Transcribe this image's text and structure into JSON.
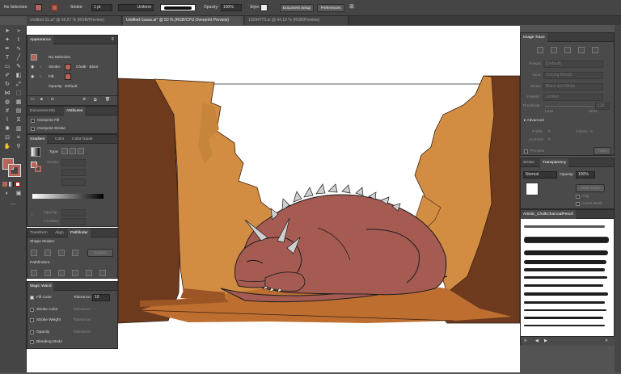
{
  "control_bar": {
    "selection": "No Selection",
    "stroke_label": "Stroke:",
    "stroke_weight": "1 pt",
    "profile": "Uniform",
    "opacity_label": "Opacity:",
    "opacity_value": "100%",
    "style_label": "Style:",
    "document_setup": "Document Setup",
    "preferences": "Preferences",
    "fill_color": "#b5655a"
  },
  "tabs": [
    {
      "label": "Untitled-11.ai* @ 66,67 % (RGB/Preview)"
    },
    {
      "label": "Untitled-1sasa.ai* @ 50 % (RGB/CPU Overprint Preview)"
    },
    {
      "label": "10294773.ai @ 94,12 % (RGB/Preview)"
    }
  ],
  "appearance": {
    "title": "Appearance",
    "selection": "No Selection",
    "stroke_label": "Stroke:",
    "stroke_value": "Chalk - Blunt",
    "fill_label": "Fill:",
    "opacity_label": "Opacity:",
    "opacity_value": "Default",
    "fx": "fx"
  },
  "doc_info": {
    "tab1": "Document Info",
    "tab2": "Attributes",
    "overprint_fill": "Overprint Fill",
    "overprint_stroke": "Overprint Stroke"
  },
  "gradient": {
    "tab1": "Gradient",
    "tab2": "Color",
    "tab3": "Color Guide",
    "type_label": "Type:",
    "stroke_label": "Stroke:",
    "opacity_label": "Opacity:",
    "location_label": "Location:"
  },
  "transform": {
    "tab1": "Transform",
    "tab2": "Align",
    "tab3": "Pathfinder",
    "shape_modes": "Shape Modes:",
    "pathfinders": "Pathfinders:",
    "expand": "Expand"
  },
  "magic_wand": {
    "title": "Magic Wand",
    "fill_color": "Fill Color",
    "tolerance": "Tolerance:",
    "tolerance_value": "10",
    "stroke_color": "Stroke Color",
    "stroke_weight": "Stroke Weight",
    "opacity": "Opacity",
    "blending_mode": "Blending Mode"
  },
  "image_trace": {
    "title": "Image Trace",
    "preset": "Preset:",
    "preset_value": "[Default]",
    "view": "View:",
    "view_value": "Tracing Result",
    "mode": "Mode:",
    "mode_value": "Black and White",
    "palette": "Palette:",
    "palette_value": "Limited",
    "threshold": "Threshold:",
    "threshold_value": "128",
    "less": "Less",
    "more": "More",
    "advanced": "Advanced",
    "paths": "Paths:",
    "paths_value": "0",
    "colors": "Colors:",
    "colors_value": "0",
    "anchors": "Anchors:",
    "anchors_value": "0",
    "preview": "Preview",
    "trace": "Trace"
  },
  "transparency": {
    "tab1": "Stroke",
    "tab2": "Transparency",
    "mode": "Normal",
    "opacity_label": "Opacity:",
    "opacity_value": "100%",
    "make_mask": "Make Mask",
    "clip": "Clip",
    "invert_mask": "Invert Mask"
  },
  "brushes": {
    "title": "Artistic_ChalkCharcoalPencil"
  },
  "colors": {
    "fill_swatch": "#b5655a",
    "dragon_body": "#a65b52",
    "canyon_light": "#d38d43",
    "canyon_dark": "#6e3a1e",
    "canyon_floor": "#be6f30"
  }
}
